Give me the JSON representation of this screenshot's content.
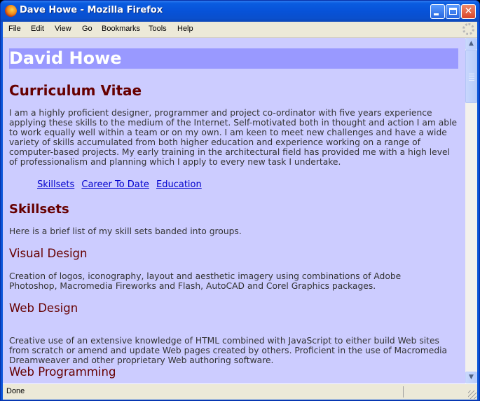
{
  "window": {
    "title": "Dave Howe - Mozilla Firefox"
  },
  "menu": [
    "File",
    "Edit",
    "View",
    "Go",
    "Bookmarks",
    "Tools",
    "Help"
  ],
  "status": {
    "text": "Done"
  },
  "page": {
    "name": "David Howe",
    "cv_heading": "Curriculum Vitae",
    "intro": "I am a highly proficient designer, programmer and project co-ordinator with five years experience applying these skills to the medium of the Internet. Self-motivated both in thought and action I am able to work equally well within a team or on my own. I am keen to meet new challenges and have a wide variety of skills accumulated from both higher education and experience working on a range of computer-based projects. My early training in the architectural field has provided me with a high level of professionalism and planning which I apply to every new task I undertake.",
    "nav_links": [
      "Skillsets",
      "Career To Date",
      "Education"
    ],
    "skillsets_heading": "Skillsets",
    "skillsets_intro": "Here is a brief list of my skill sets banded into groups.",
    "sections": [
      {
        "title": "Visual Design",
        "body": "Creation of logos, iconography, layout and aesthetic imagery using combinations of Adobe Photoshop, Macromedia Fireworks and Flash, AutoCAD and Corel Graphics packages."
      },
      {
        "title": "Web Design",
        "body": "Creative use of an extensive knowledge of HTML combined with JavaScript to either build Web sites from scratch or amend and update Web pages created by others. Proficient in the use of Macromedia Dreamweaver and other proprietary Web authoring software."
      },
      {
        "title": "Web Programming",
        "body": ""
      }
    ]
  },
  "colors": {
    "page_background": "#ccccff",
    "name_banner": "#9999ff",
    "heading": "#660000",
    "link": "#0000cc"
  }
}
